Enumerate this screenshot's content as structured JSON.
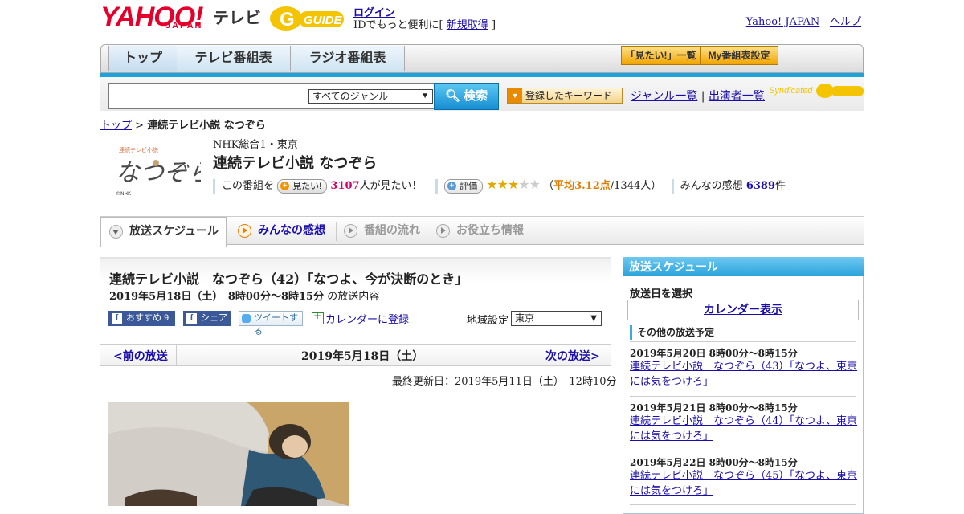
{
  "header": {
    "logo_text": "YAHOO!",
    "logo_sub": "JAPAN",
    "service_name": "テレビ",
    "guide_logo": "G-GUIDE",
    "login_link": "ログイン",
    "login_sub_prefix": "IDでもっと便利に[",
    "register_link": "新規取得",
    "login_sub_suffix": "]",
    "top_link_yahoo": "Yahoo! JAPAN",
    "top_link_sep": "-",
    "top_link_help": "ヘルプ"
  },
  "nav": {
    "tabs": [
      "トップ",
      "テレビ番組表",
      "ラジオ番組表"
    ],
    "mitai_list": "「見たい!」一覧",
    "my_schedule": "My番組表設定"
  },
  "search": {
    "input_value": "",
    "genre_selected": "すべてのジャンル",
    "search_button": "検索",
    "keyword_button": "登録したキーワード",
    "genre_list": "ジャンル一覧",
    "divider": "|",
    "performer_list": "出演者一覧",
    "syndicated": "Syndicated"
  },
  "breadcrumb": {
    "top": "トップ",
    "sep": ">",
    "current": "連続テレビ小説 なつぞら"
  },
  "program": {
    "channel": "NHK総合1・東京",
    "title": "連続テレビ小説 なつぞら",
    "mitai_prefix": "この番組を",
    "mitai_button": "見たい!",
    "mitai_count": "3107",
    "mitai_suffix": "人が見たい！",
    "rating_button": "評価",
    "rating": 3.12,
    "rating_open": "（",
    "rating_avg": "平均3.12点",
    "rating_count": "/1344人）",
    "impressions_prefix": "みんなの感想",
    "impressions_count": "6389",
    "impressions_suffix": "件",
    "logo_credit": "©NHK"
  },
  "tabs": {
    "schedule": "放送スケジュール",
    "impressions": "みんなの感想",
    "flow": "番組の流れ",
    "info": "お役立ち情報"
  },
  "episode": {
    "title": "連続テレビ小説　なつぞら（42）「なつよ、今が決断のとき」",
    "date_time": "2019年5月18日（土）　8時00分～8時15分",
    "date_suffix": "の放送内容",
    "recommend": "おすすめ 9",
    "share": "シェア",
    "tweet": "ツイートする",
    "calendar_add": "カレンダーに登録",
    "region_label": "地域設定",
    "region_selected": "東京",
    "prev": "<前の放送",
    "current_date": "2019年5月18日（土）",
    "next": "次の放送>",
    "updated": "最終更新日：2019年5月11日（土）　12時10分"
  },
  "sidebar": {
    "header": "放送スケジュール",
    "select_date": "放送日を選択",
    "calendar_button": "カレンダー表示",
    "other_schedules": "その他の放送予定",
    "items": [
      {
        "date": "2019年5月20日  8時00分～8時15分",
        "title": "連続テレビ小説　なつぞら（43）「なつよ、東京には気をつけろ」"
      },
      {
        "date": "2019年5月21日  8時00分～8時15分",
        "title": "連続テレビ小説　なつぞら（44）「なつよ、東京には気をつけろ」"
      },
      {
        "date": "2019年5月22日  8時00分～8時15分",
        "title": "連続テレビ小説　なつぞら（45）「なつよ、東京には気をつけろ」"
      }
    ]
  },
  "colors": {
    "yahoo_red": "#e4002b",
    "accent_blue": "#1aa3dc",
    "link": "#1a0dab",
    "pink_count": "#d6006b",
    "star": "#e5a800"
  }
}
